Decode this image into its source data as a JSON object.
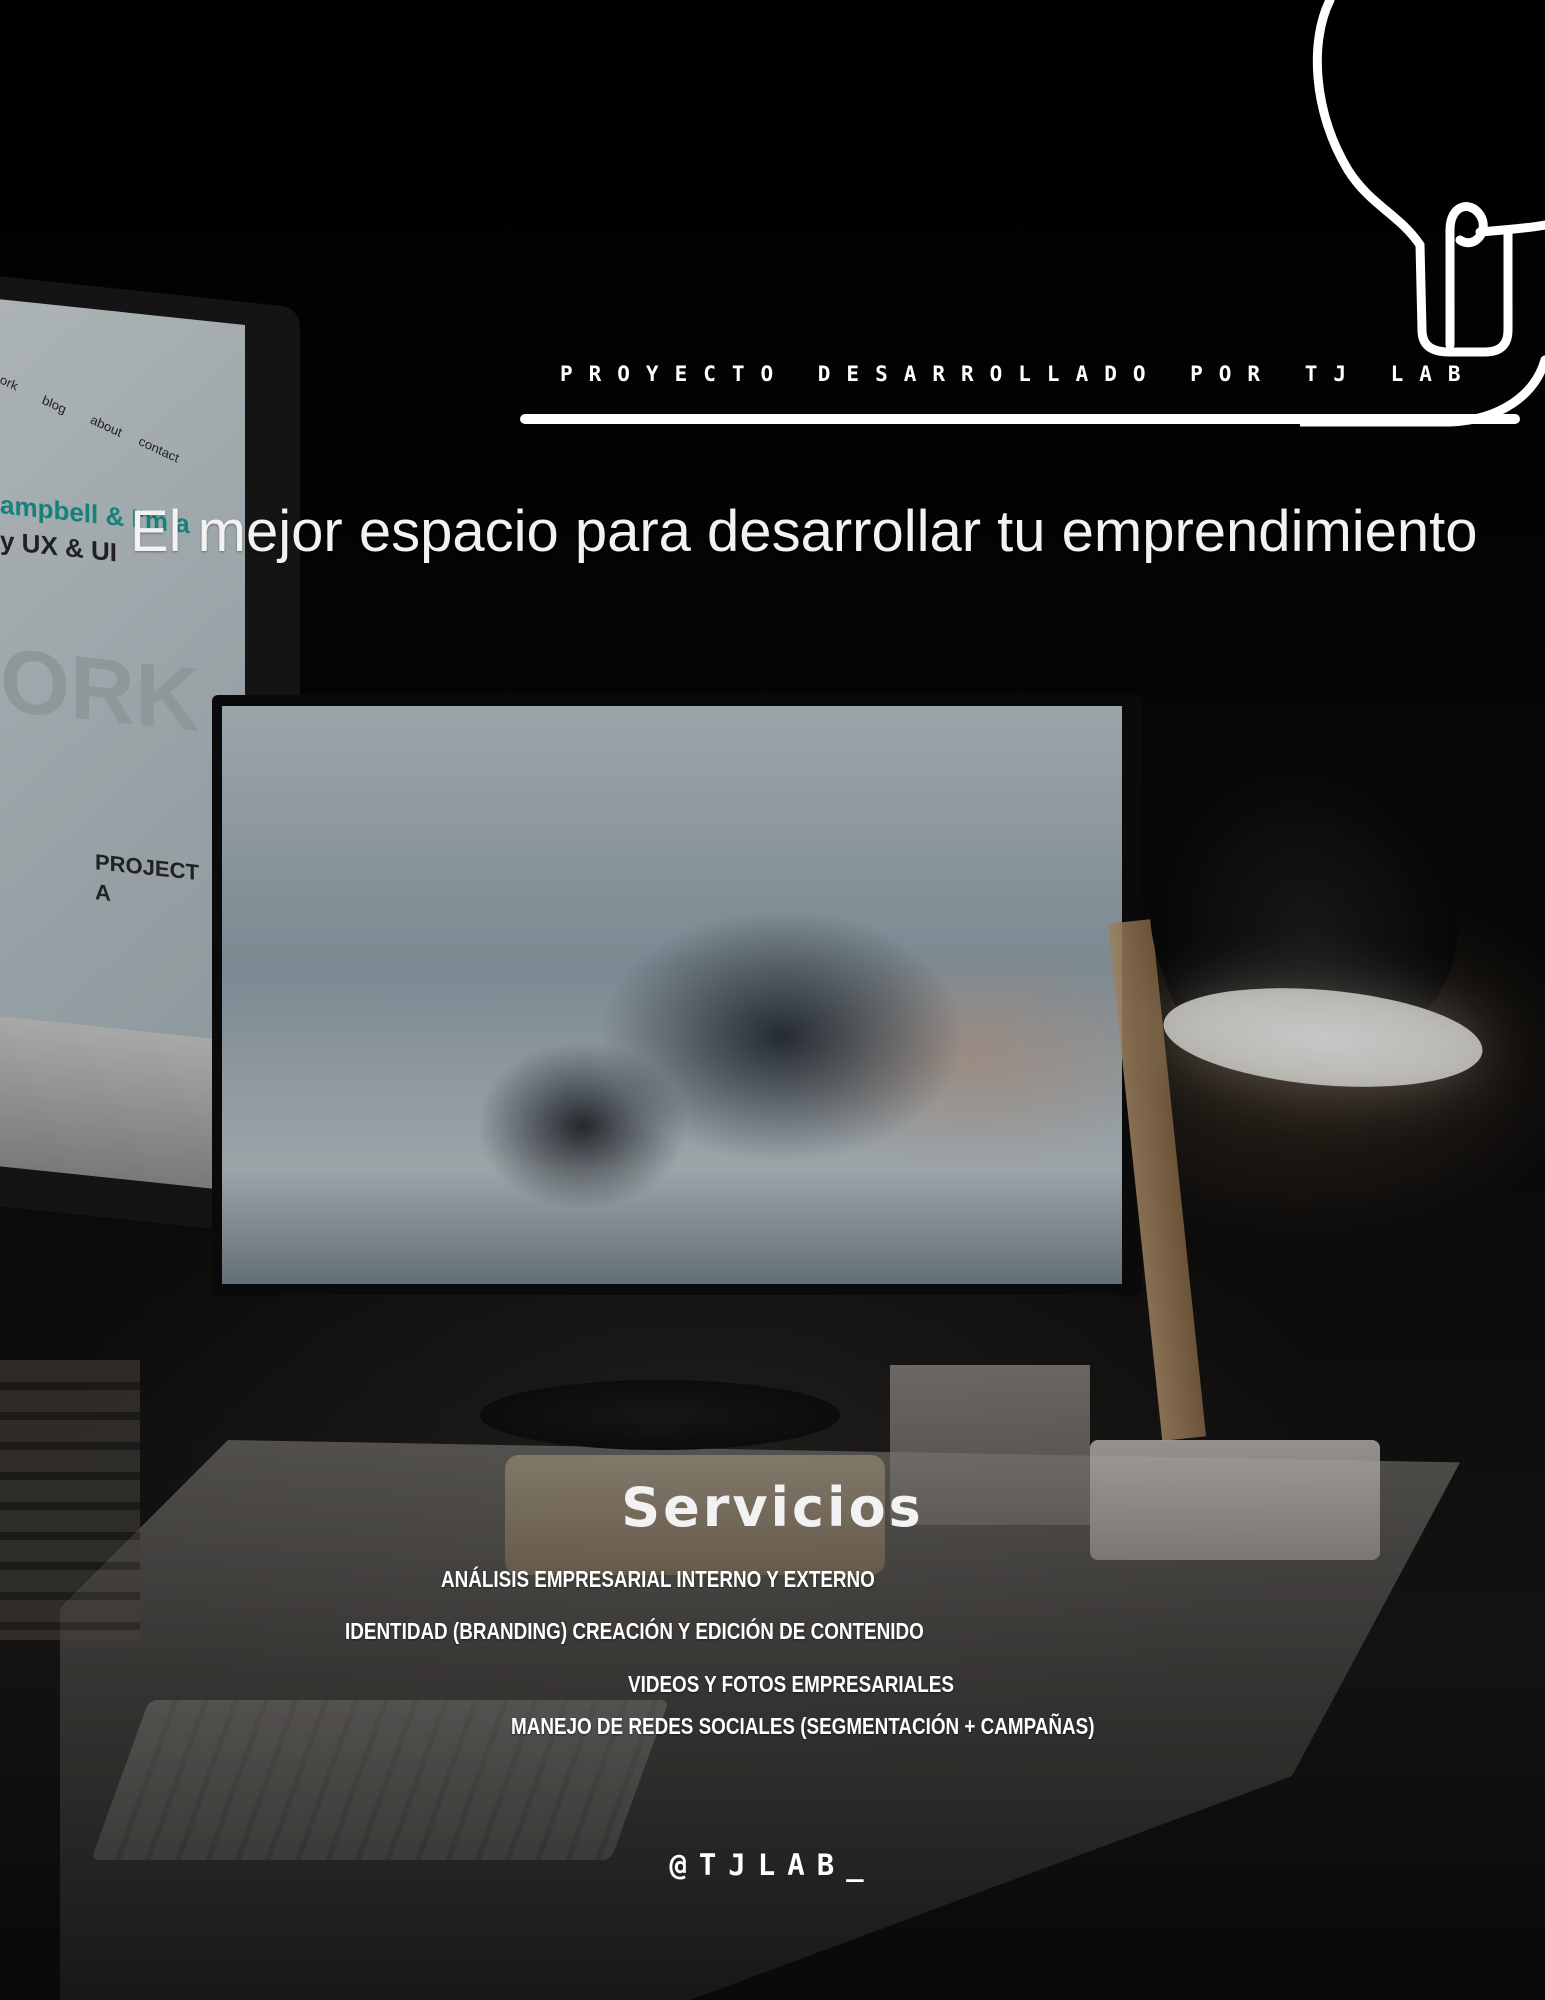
{
  "header": {
    "credit": "PROYECTO DESARROLLADO POR TJ LAB",
    "logo_icon": "lightbulb-icon"
  },
  "hero": {
    "headline": "El mejor espacio para desarrollar tu emprendimiento"
  },
  "background_photo": {
    "screen_text": {
      "nav": [
        "ork",
        "blog",
        "about",
        "contact"
      ],
      "intro_line_1": "ampbell & I'm a",
      "intro_line_2": "y UX & UI",
      "big_word": "ORK",
      "project_title_1": "PROJECT",
      "project_title_2": "A"
    }
  },
  "services": {
    "title": "Servicios",
    "items": [
      "ANÁLISIS EMPRESARIAL INTERNO Y EXTERNO",
      "IDENTIDAD (BRANDING) CREACIÓN Y EDICIÓN DE CONTENIDO",
      "VIDEOS Y FOTOS EMPRESARIALES",
      "MANEJO DE REDES SOCIALES (SEGMENTACIÓN + CAMPAÑAS)"
    ]
  },
  "footer": {
    "handle": "@TJLAB_"
  },
  "colors": {
    "background": "#050505",
    "text": "#ffffff",
    "lamp_light": "#f1efe9"
  }
}
